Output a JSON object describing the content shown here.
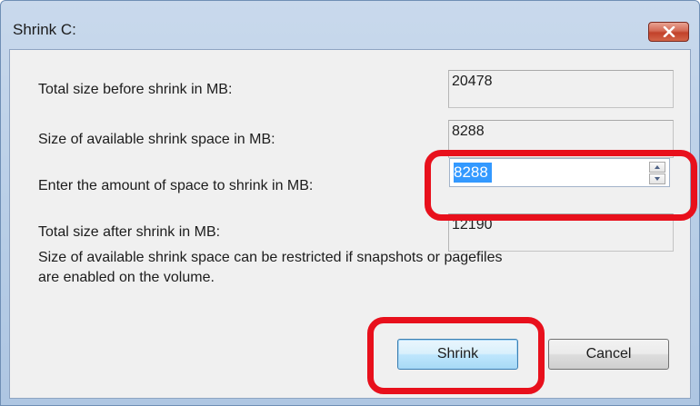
{
  "window": {
    "title": "Shrink C:"
  },
  "fields": {
    "total_before": {
      "label": "Total size before shrink in MB:",
      "value": "20478"
    },
    "available": {
      "label": "Size of available shrink space in MB:",
      "value": "8288"
    },
    "amount": {
      "label": "Enter the amount of space to shrink in MB:",
      "value": "8288"
    },
    "total_after": {
      "label": "Total size after shrink in MB:",
      "value": "12190"
    }
  },
  "note": {
    "line1": "Size of available shrink space can be restricted if snapshots or pagefiles",
    "line2": "are enabled on the volume."
  },
  "buttons": {
    "shrink": "Shrink",
    "cancel": "Cancel"
  },
  "icons": {
    "close": "close-icon",
    "spin_up": "chevron-up-icon",
    "spin_down": "chevron-down-icon"
  },
  "colors": {
    "annotation": "#e8101c",
    "selection": "#3399ff",
    "close_button": "#c2412a"
  }
}
